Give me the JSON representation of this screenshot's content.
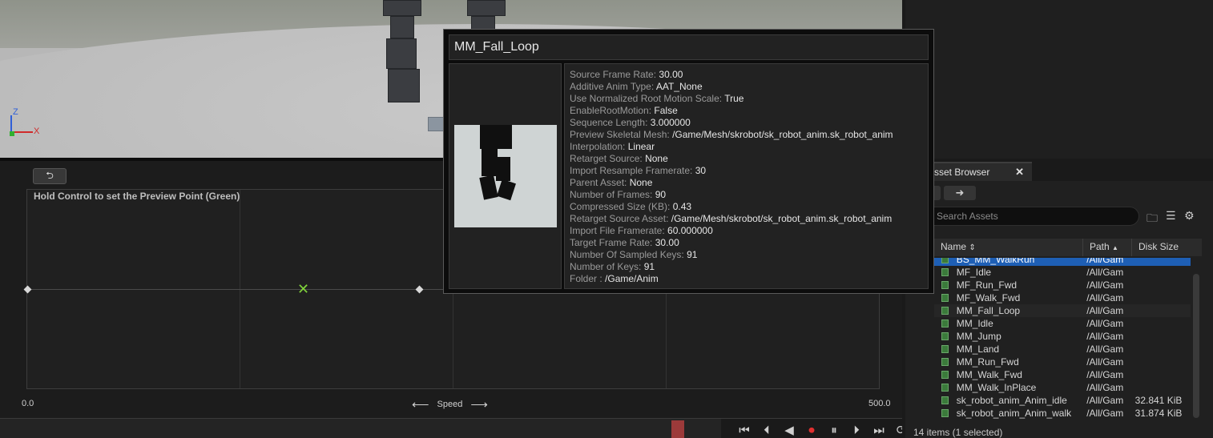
{
  "graph": {
    "hint": "Hold Control to set the Preview Point (Green)",
    "axis_min": "0.0",
    "axis_max": "500.0",
    "axis_name": "Speed",
    "arrow_left": "⟵",
    "arrow_right": "⟶"
  },
  "asset_browser": {
    "tab_label": "sset Browser",
    "search_placeholder": "Search Assets",
    "columns": {
      "name": "Name",
      "path": "Path",
      "disk_size": "Disk Size"
    },
    "rows": [
      {
        "name": "BS_MM_WalkRun",
        "path": "/All/Gam",
        "size": "",
        "selected": true
      },
      {
        "name": "MF_Idle",
        "path": "/All/Gam",
        "size": ""
      },
      {
        "name": "MF_Run_Fwd",
        "path": "/All/Gam",
        "size": ""
      },
      {
        "name": "MF_Walk_Fwd",
        "path": "/All/Gam",
        "size": ""
      },
      {
        "name": "MM_Fall_Loop",
        "path": "/All/Gam",
        "size": "",
        "hover": true
      },
      {
        "name": "MM_Idle",
        "path": "/All/Gam",
        "size": ""
      },
      {
        "name": "MM_Jump",
        "path": "/All/Gam",
        "size": ""
      },
      {
        "name": "MM_Land",
        "path": "/All/Gam",
        "size": ""
      },
      {
        "name": "MM_Run_Fwd",
        "path": "/All/Gam",
        "size": ""
      },
      {
        "name": "MM_Walk_Fwd",
        "path": "/All/Gam",
        "size": ""
      },
      {
        "name": "MM_Walk_InPlace",
        "path": "/All/Gam",
        "size": ""
      },
      {
        "name": "sk_robot_anim_Anim_idle",
        "path": "/All/Gam",
        "size": "32.841 KiB"
      },
      {
        "name": "sk_robot_anim_Anim_walk",
        "path": "/All/Gam",
        "size": "31.874 KiB"
      }
    ],
    "status": "14 items (1 selected)"
  },
  "tooltip": {
    "title": "MM_Fall_Loop",
    "props": [
      {
        "k": "Source Frame Rate:",
        "v": "30.00"
      },
      {
        "k": "Additive Anim Type:",
        "v": "AAT_None"
      },
      {
        "k": "Use Normalized Root Motion Scale:",
        "v": "True"
      },
      {
        "k": "EnableRootMotion:",
        "v": "False"
      },
      {
        "k": "Sequence Length:",
        "v": "3.000000"
      },
      {
        "k": "Preview Skeletal Mesh:",
        "v": "/Game/Mesh/skrobot/sk_robot_anim.sk_robot_anim"
      },
      {
        "k": "Interpolation:",
        "v": "Linear"
      },
      {
        "k": "Retarget Source:",
        "v": "None"
      },
      {
        "k": "Import Resample Framerate:",
        "v": "30"
      },
      {
        "k": "Parent Asset:",
        "v": "None"
      },
      {
        "k": "Number of Frames:",
        "v": "90"
      },
      {
        "k": "Compressed Size (KB):",
        "v": "0.43"
      },
      {
        "k": "Retarget Source Asset:",
        "v": "/Game/Mesh/skrobot/sk_robot_anim.sk_robot_anim"
      },
      {
        "k": "Import File Framerate:",
        "v": "60.000000"
      },
      {
        "k": "Target Frame Rate:",
        "v": "30.00"
      },
      {
        "k": "Number Of Sampled Keys:",
        "v": "91"
      },
      {
        "k": "Number of Keys:",
        "v": "91"
      },
      {
        "k": "Folder :",
        "v": "/Game/Anim"
      }
    ]
  },
  "gizmo": {
    "z": "Z",
    "x": "X"
  },
  "icons": {
    "back": "back-arrow-icon",
    "forward": "forward-arrow-icon",
    "close": "close-icon",
    "folder": "folder-icon",
    "filter": "filter-icon",
    "settings": "gear-icon",
    "asset": "animation-asset-icon",
    "sort": "sort-ascending-icon"
  },
  "symbols": {
    "close": "✕",
    "forward": "➜",
    "folder": "🗀",
    "filter": "☰",
    "gear": "⚙",
    "sort": "⇕",
    "sort_up": "▲"
  },
  "transport": [
    "⏮",
    "⏴",
    "◀",
    "⏺",
    "⏸",
    "⏵",
    "⏭",
    "⟳"
  ]
}
